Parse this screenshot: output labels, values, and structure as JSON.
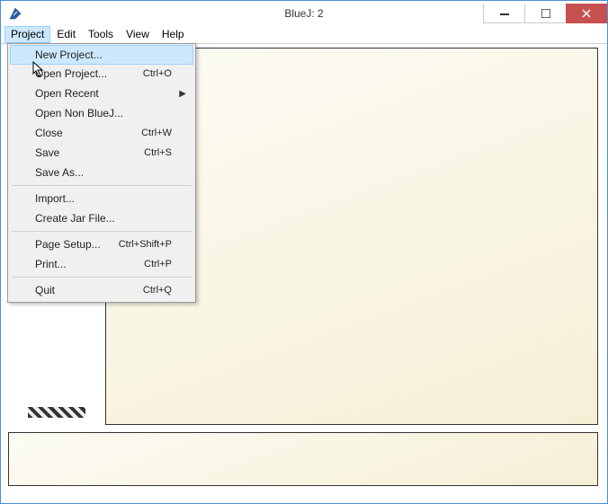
{
  "window": {
    "title": "BlueJ:  2"
  },
  "menubar": {
    "items": [
      "Project",
      "Edit",
      "Tools",
      "View",
      "Help"
    ],
    "active_index": 0
  },
  "dropdown": {
    "groups": [
      [
        {
          "label": "New Project...",
          "shortcut": "",
          "submenu": false,
          "highlighted": true
        },
        {
          "label": "Open Project...",
          "shortcut": "Ctrl+O",
          "submenu": false,
          "highlighted": false
        },
        {
          "label": "Open Recent",
          "shortcut": "",
          "submenu": true,
          "highlighted": false
        },
        {
          "label": "Open Non BlueJ...",
          "shortcut": "",
          "submenu": false,
          "highlighted": false
        },
        {
          "label": "Close",
          "shortcut": "Ctrl+W",
          "submenu": false,
          "highlighted": false
        },
        {
          "label": "Save",
          "shortcut": "Ctrl+S",
          "submenu": false,
          "highlighted": false
        },
        {
          "label": "Save As...",
          "shortcut": "",
          "submenu": false,
          "highlighted": false
        }
      ],
      [
        {
          "label": "Import...",
          "shortcut": "",
          "submenu": false,
          "highlighted": false
        },
        {
          "label": "Create Jar File...",
          "shortcut": "",
          "submenu": false,
          "highlighted": false
        }
      ],
      [
        {
          "label": "Page Setup...",
          "shortcut": "Ctrl+Shift+P",
          "submenu": false,
          "highlighted": false
        },
        {
          "label": "Print...",
          "shortcut": "Ctrl+P",
          "submenu": false,
          "highlighted": false
        }
      ],
      [
        {
          "label": "Quit",
          "shortcut": "Ctrl+Q",
          "submenu": false,
          "highlighted": false
        }
      ]
    ]
  }
}
